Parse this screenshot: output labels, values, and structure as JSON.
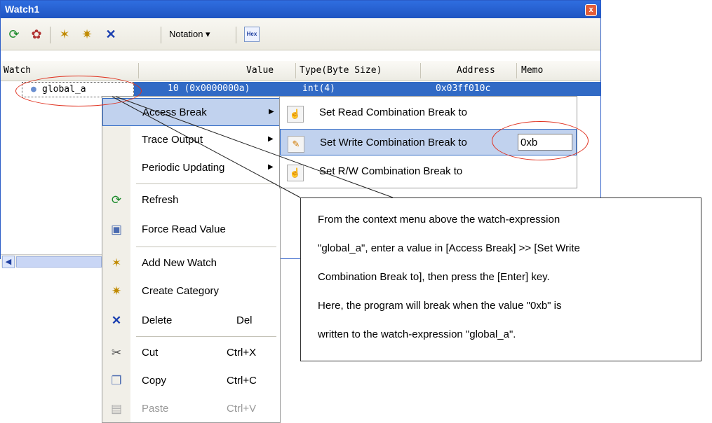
{
  "window": {
    "title": "Watch1",
    "close_glyph": "x"
  },
  "toolbar": {
    "icons": [
      "refresh-icon",
      "palette-icon",
      "add-watch-icon",
      "create-category-icon",
      "delete-icon"
    ],
    "notation_label": "Notation",
    "notation_arrow": "▾",
    "hex_label": "Hex"
  },
  "columns": {
    "watch": "Watch",
    "value": "Value",
    "type": "Type(Byte Size)",
    "address": "Address",
    "memo": "Memo"
  },
  "row": {
    "name": "global_a",
    "value": "10 (0x0000000a)",
    "type": "int(4)",
    "address": "0x03ff010c"
  },
  "context_menu": {
    "items": [
      {
        "label": "Access Break",
        "has_submenu": true
      },
      {
        "label": "Trace Output",
        "has_submenu": true
      },
      {
        "label": "Periodic Updating",
        "has_submenu": true
      },
      {
        "label": "Refresh",
        "icon": "refresh-icon"
      },
      {
        "label": "Force Read Value",
        "icon": "force-read-icon"
      },
      {
        "label": "Add New Watch",
        "icon": "add-watch-icon"
      },
      {
        "label": "Create Category",
        "icon": "create-category-icon"
      },
      {
        "label": "Delete",
        "shortcut": "Del",
        "icon": "delete-icon"
      },
      {
        "label": "Cut",
        "shortcut": "Ctrl+X",
        "icon": "cut-icon"
      },
      {
        "label": "Copy",
        "shortcut": "Ctrl+C",
        "icon": "copy-icon"
      },
      {
        "label": "Paste",
        "shortcut": "Ctrl+V",
        "icon": "paste-icon",
        "disabled": true
      }
    ]
  },
  "submenu": {
    "items": [
      {
        "label": "Set Read Combination Break to"
      },
      {
        "label": "Set Write Combination Break to",
        "input_value": "0xb"
      },
      {
        "label": "Set R/W Combination Break to"
      }
    ]
  },
  "callout": {
    "lines": [
      "From the context menu above the watch-expression",
      "\"global_a\", enter a value in [Access Break] >> [Set Write",
      "Combination Break to], then press the [Enter] key.",
      "Here, the program will break when the value \"0xb\" is",
      "written to the watch-expression \"global_a\"."
    ]
  },
  "colors": {
    "title_bar": "#2f6ee0",
    "selection": "#316ac5",
    "highlight": "#c1d2ee",
    "annotation": "#e0301e"
  }
}
